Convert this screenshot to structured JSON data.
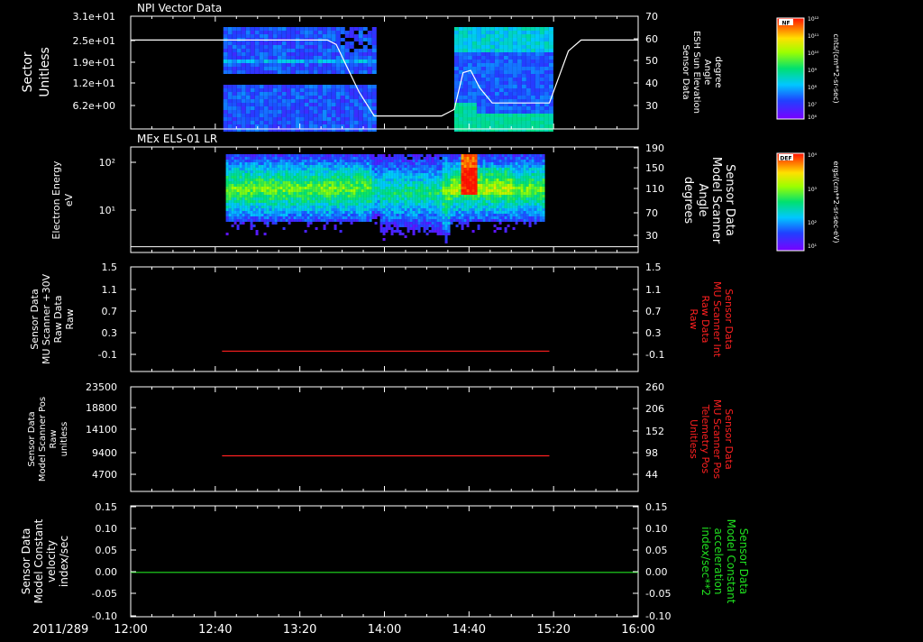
{
  "window": {
    "background": "#000000",
    "foreground": "#ffffff"
  },
  "time_axis": {
    "date_label": "2011/289",
    "tick_labels": [
      "12:00",
      "12:40",
      "13:20",
      "14:00",
      "14:40",
      "15:20",
      "16:00"
    ],
    "tick_hours": [
      12.0,
      12.6667,
      13.3333,
      14.0,
      14.6667,
      15.3333,
      16.0
    ],
    "range_hours": [
      12.0,
      16.0
    ]
  },
  "colorbars": [
    {
      "badge": "NF",
      "units": "cnts/(cm**2-sr-sec)",
      "ticks": [
        "10¹²",
        "10¹¹",
        "10¹⁰",
        "10⁹",
        "10⁸",
        "10⁷",
        "10⁶"
      ]
    },
    {
      "badge": "DEF",
      "units": "ergs/(cm**2-sr-sec-eV)",
      "ticks": [
        "10⁴",
        "10³",
        "10²",
        "10¹"
      ]
    }
  ],
  "chart_data": [
    {
      "type": "heatmap",
      "title": "NPI Vector Data",
      "ylabel": [
        "Sector",
        "Unitless"
      ],
      "yticks": [
        "3.1e+01",
        "2.5e+01",
        "1.9e+01",
        "1.2e+01",
        "6.2e+00"
      ],
      "ylim": [
        0,
        31
      ],
      "right_ylabel": [
        "Sensor Data",
        "ESH Sun Elevation",
        "Angle",
        "degree"
      ],
      "right_yticks": [
        "70",
        "60",
        "50",
        "40",
        "30"
      ],
      "right_ylim": [
        19,
        71
      ],
      "data_intervals_hours": [
        [
          12.73,
          13.92
        ],
        [
          14.55,
          15.3
        ]
      ],
      "overlay_line": {
        "color": "#ffffff",
        "x_hours": [
          12.0,
          13.55,
          13.62,
          13.8,
          13.92,
          14.45,
          14.55,
          14.62,
          14.68,
          14.75,
          14.85,
          15.3,
          15.45,
          15.55,
          16.0
        ],
        "y_degrees": [
          60,
          60,
          58,
          36,
          25,
          25,
          28,
          45,
          46,
          38,
          31,
          31,
          55,
          60,
          60
        ]
      }
    },
    {
      "type": "heatmap",
      "title": "MEx ELS-01 LR",
      "ylabel": [
        "Electron Energy",
        "eV"
      ],
      "yticks": [
        "10²",
        "10¹"
      ],
      "ylim_log": [
        0,
        2.2
      ],
      "right_ylabel": [
        "Sensor Data",
        "Model Scanner",
        "Angle",
        "degrees"
      ],
      "right_yticks": [
        "190",
        "150",
        "110",
        "70",
        "30"
      ],
      "right_ylim": [
        5,
        190
      ],
      "data_interval_hours": [
        12.75,
        15.26
      ],
      "overlay_line": {
        "color": "#ffffff",
        "x_hours": [
          12.0,
          16.0
        ],
        "y_degrees": [
          15,
          15
        ]
      }
    },
    {
      "type": "line",
      "ylabel": [
        "Sensor Data",
        "MU Scanner +30V",
        "Raw Data",
        "Raw"
      ],
      "yticks": [
        "1.5",
        "1.1",
        "0.7",
        "0.3",
        "-0.1"
      ],
      "ylim": [
        -0.3,
        1.5
      ],
      "right_ylabel": [
        "Sensor Data",
        "MU Scanner Int",
        "Raw Data",
        "Raw"
      ],
      "right_label_color": "#ff2020",
      "right_yticks": [
        "1.5",
        "1.1",
        "0.7",
        "0.3",
        "-0.1"
      ],
      "series": [
        {
          "color": "#ff2020",
          "x_hours": [
            12.72,
            15.3
          ],
          "y": [
            0.05,
            0.05
          ]
        }
      ]
    },
    {
      "type": "line",
      "ylabel": [
        "Sensor Data",
        "Model Scanner Pos",
        "Raw",
        "unitless"
      ],
      "yticks": [
        "23500",
        "18800",
        "14100",
        "9400",
        "4700"
      ],
      "ylim": [
        0,
        23500
      ],
      "right_ylabel": [
        "Sensor Data",
        "MU Scanner Pos",
        "Telemetry Pos",
        "Unitless"
      ],
      "right_label_color": "#ff2020",
      "right_yticks": [
        "260",
        "206",
        "152",
        "98",
        "44"
      ],
      "series": [
        {
          "color": "#ff2020",
          "x_hours": [
            12.72,
            15.3
          ],
          "y": [
            8000,
            8000
          ]
        }
      ]
    },
    {
      "type": "line",
      "ylabel": [
        "Sensor Data",
        "Model Constant",
        "velocity",
        "index/sec"
      ],
      "yticks": [
        "0.15",
        "0.10",
        "0.05",
        "0.00",
        "-0.05",
        "-0.10"
      ],
      "ylim": [
        -0.1,
        0.15
      ],
      "right_ylabel": [
        "Sensor Data",
        "Model Constant",
        "acceleration",
        "index/sec**2"
      ],
      "right_label_color": "#20e020",
      "right_yticks": [
        "0.15",
        "0.10",
        "0.05",
        "0.00",
        "-0.05",
        "-0.10"
      ],
      "series": [
        {
          "color": "#20e020",
          "x_hours": [
            12.0,
            16.0
          ],
          "y": [
            0.0,
            0.0
          ]
        }
      ]
    }
  ]
}
